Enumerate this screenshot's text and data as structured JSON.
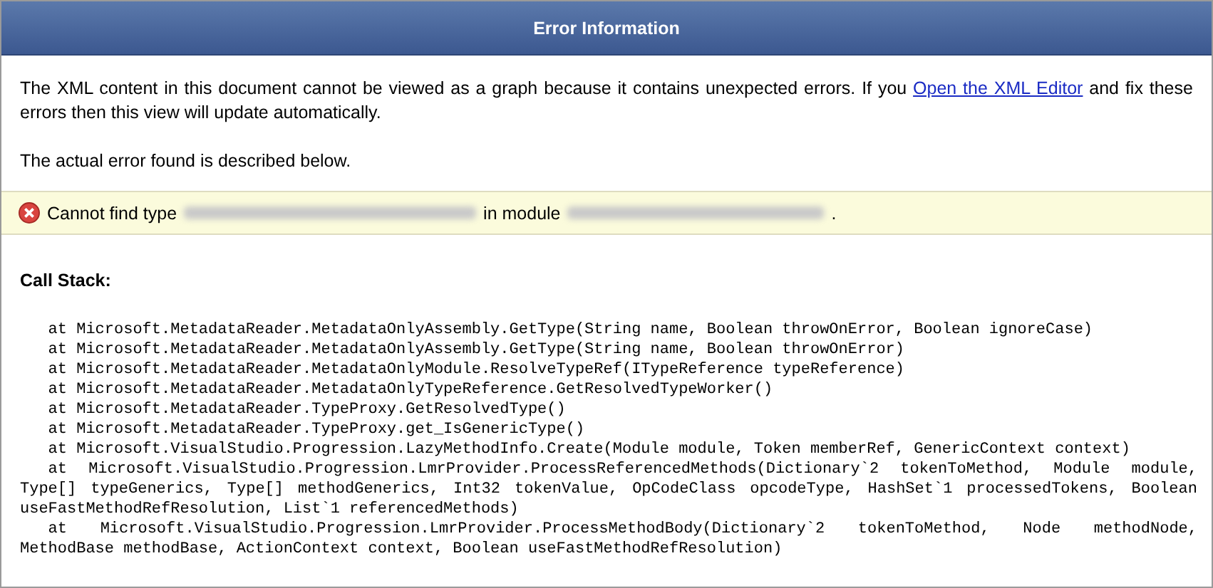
{
  "header": {
    "title": "Error Information"
  },
  "intro": {
    "before_link": "The XML content in this document cannot be viewed as a graph because it contains unexpected errors. If you",
    "link": "Open the XML Editor",
    "after_link": "and fix these errors then this view will update automatically."
  },
  "note": "The actual error found is described below.",
  "error": {
    "parts": [
      {
        "kind": "text",
        "text": "Cannot find type"
      },
      {
        "kind": "redacted"
      },
      {
        "kind": "text",
        "text": "in module"
      },
      {
        "kind": "redacted"
      },
      {
        "kind": "text",
        "text": "."
      }
    ]
  },
  "call_stack": {
    "heading": "Call Stack:",
    "frames": [
      "at Microsoft.MetadataReader.MetadataOnlyAssembly.GetType(String name, Boolean throwOnError, Boolean ignoreCase)",
      "at Microsoft.MetadataReader.MetadataOnlyAssembly.GetType(String name, Boolean throwOnError)",
      "at Microsoft.MetadataReader.MetadataOnlyModule.ResolveTypeRef(ITypeReference typeReference)",
      "at Microsoft.MetadataReader.MetadataOnlyTypeReference.GetResolvedTypeWorker()",
      "at Microsoft.MetadataReader.TypeProxy.GetResolvedType()",
      "at Microsoft.MetadataReader.TypeProxy.get_IsGenericType()",
      "at Microsoft.VisualStudio.Progression.LazyMethodInfo.Create(Module module, Token memberRef, GenericContext context)",
      "at Microsoft.VisualStudio.Progression.LmrProvider.ProcessReferencedMethods(Dictionary`2 tokenToMethod, Module module, Type[] typeGenerics, Type[] methodGenerics, Int32 tokenValue, OpCodeClass opcodeType, HashSet`1 processedTokens, Boolean useFastMethodRefResolution, List`1 referencedMethods)",
      "at Microsoft.VisualStudio.Progression.LmrProvider.ProcessMethodBody(Dictionary`2 tokenToMethod, Node methodNode, MethodBase methodBase, ActionContext context, Boolean useFastMethodRefResolution)"
    ]
  }
}
